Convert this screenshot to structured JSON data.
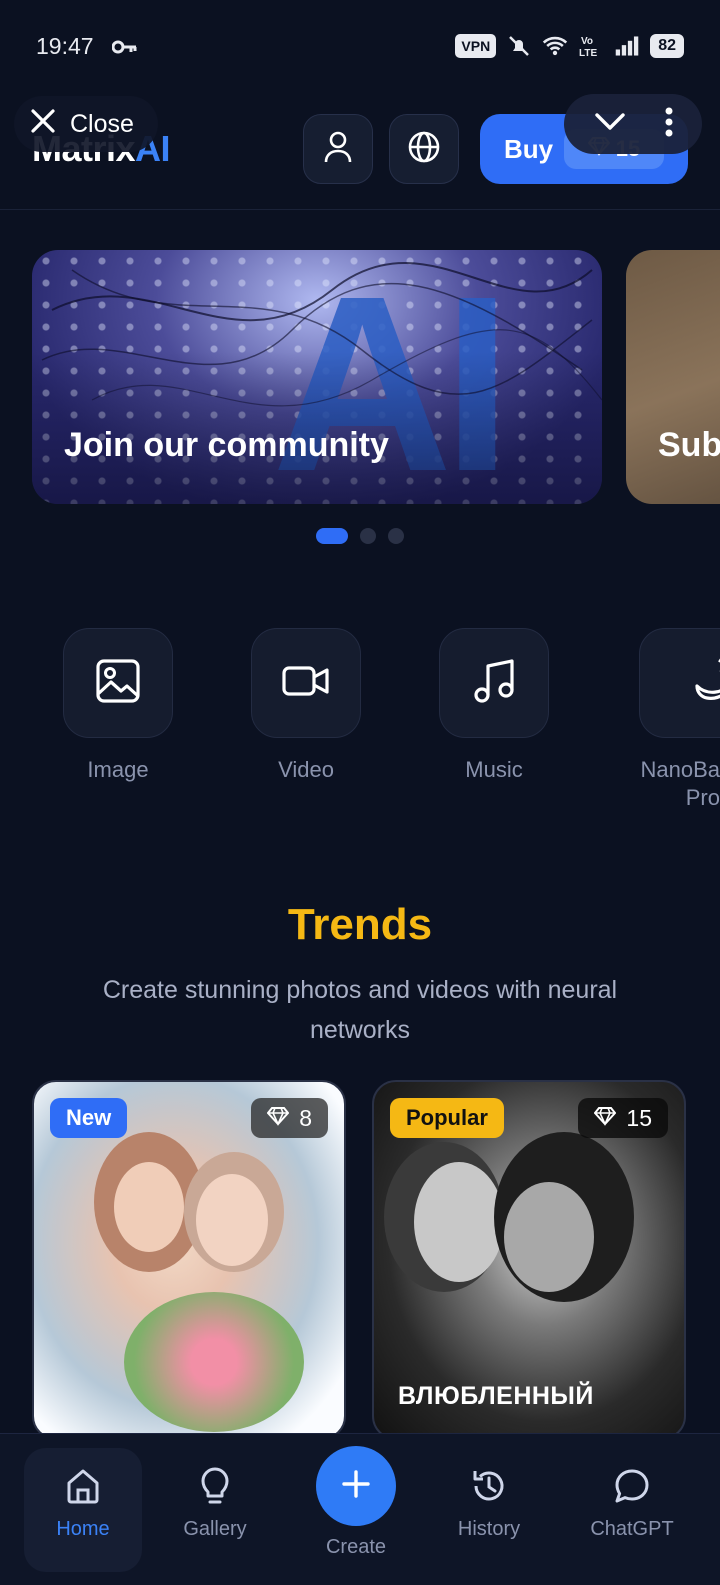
{
  "status": {
    "time": "19:47",
    "vpn": "VPN",
    "battery": "82"
  },
  "header": {
    "logo_main": "Matrix",
    "logo_accent": "AI",
    "close_label": "Close",
    "buy_label": "Buy",
    "balance": "15"
  },
  "banners": [
    {
      "title": "Join our community"
    },
    {
      "title": "Sub"
    }
  ],
  "carousel": {
    "pages": 3,
    "active": 1
  },
  "categories": [
    {
      "label": "Image",
      "icon": "image-icon"
    },
    {
      "label": "Video",
      "icon": "video-icon"
    },
    {
      "label": "Music",
      "icon": "music-icon"
    },
    {
      "label": "NanoBa\nPro",
      "icon": "banana-icon"
    }
  ],
  "trends": {
    "title": "Trends",
    "subtitle": "Create stunning photos and videos with neural networks"
  },
  "cards": [
    {
      "badge": "New",
      "cost": "8",
      "caption": ""
    },
    {
      "badge": "Popular",
      "cost": "15",
      "caption": "ВЛЮБЛЕННЫЙ"
    }
  ],
  "nav": {
    "home": "Home",
    "gallery": "Gallery",
    "create": "Create",
    "history": "History",
    "chatgpt": "ChatGPT"
  },
  "colors": {
    "background": "#0b1121",
    "accent": "#2f6df6",
    "trends": "#f5b814"
  }
}
